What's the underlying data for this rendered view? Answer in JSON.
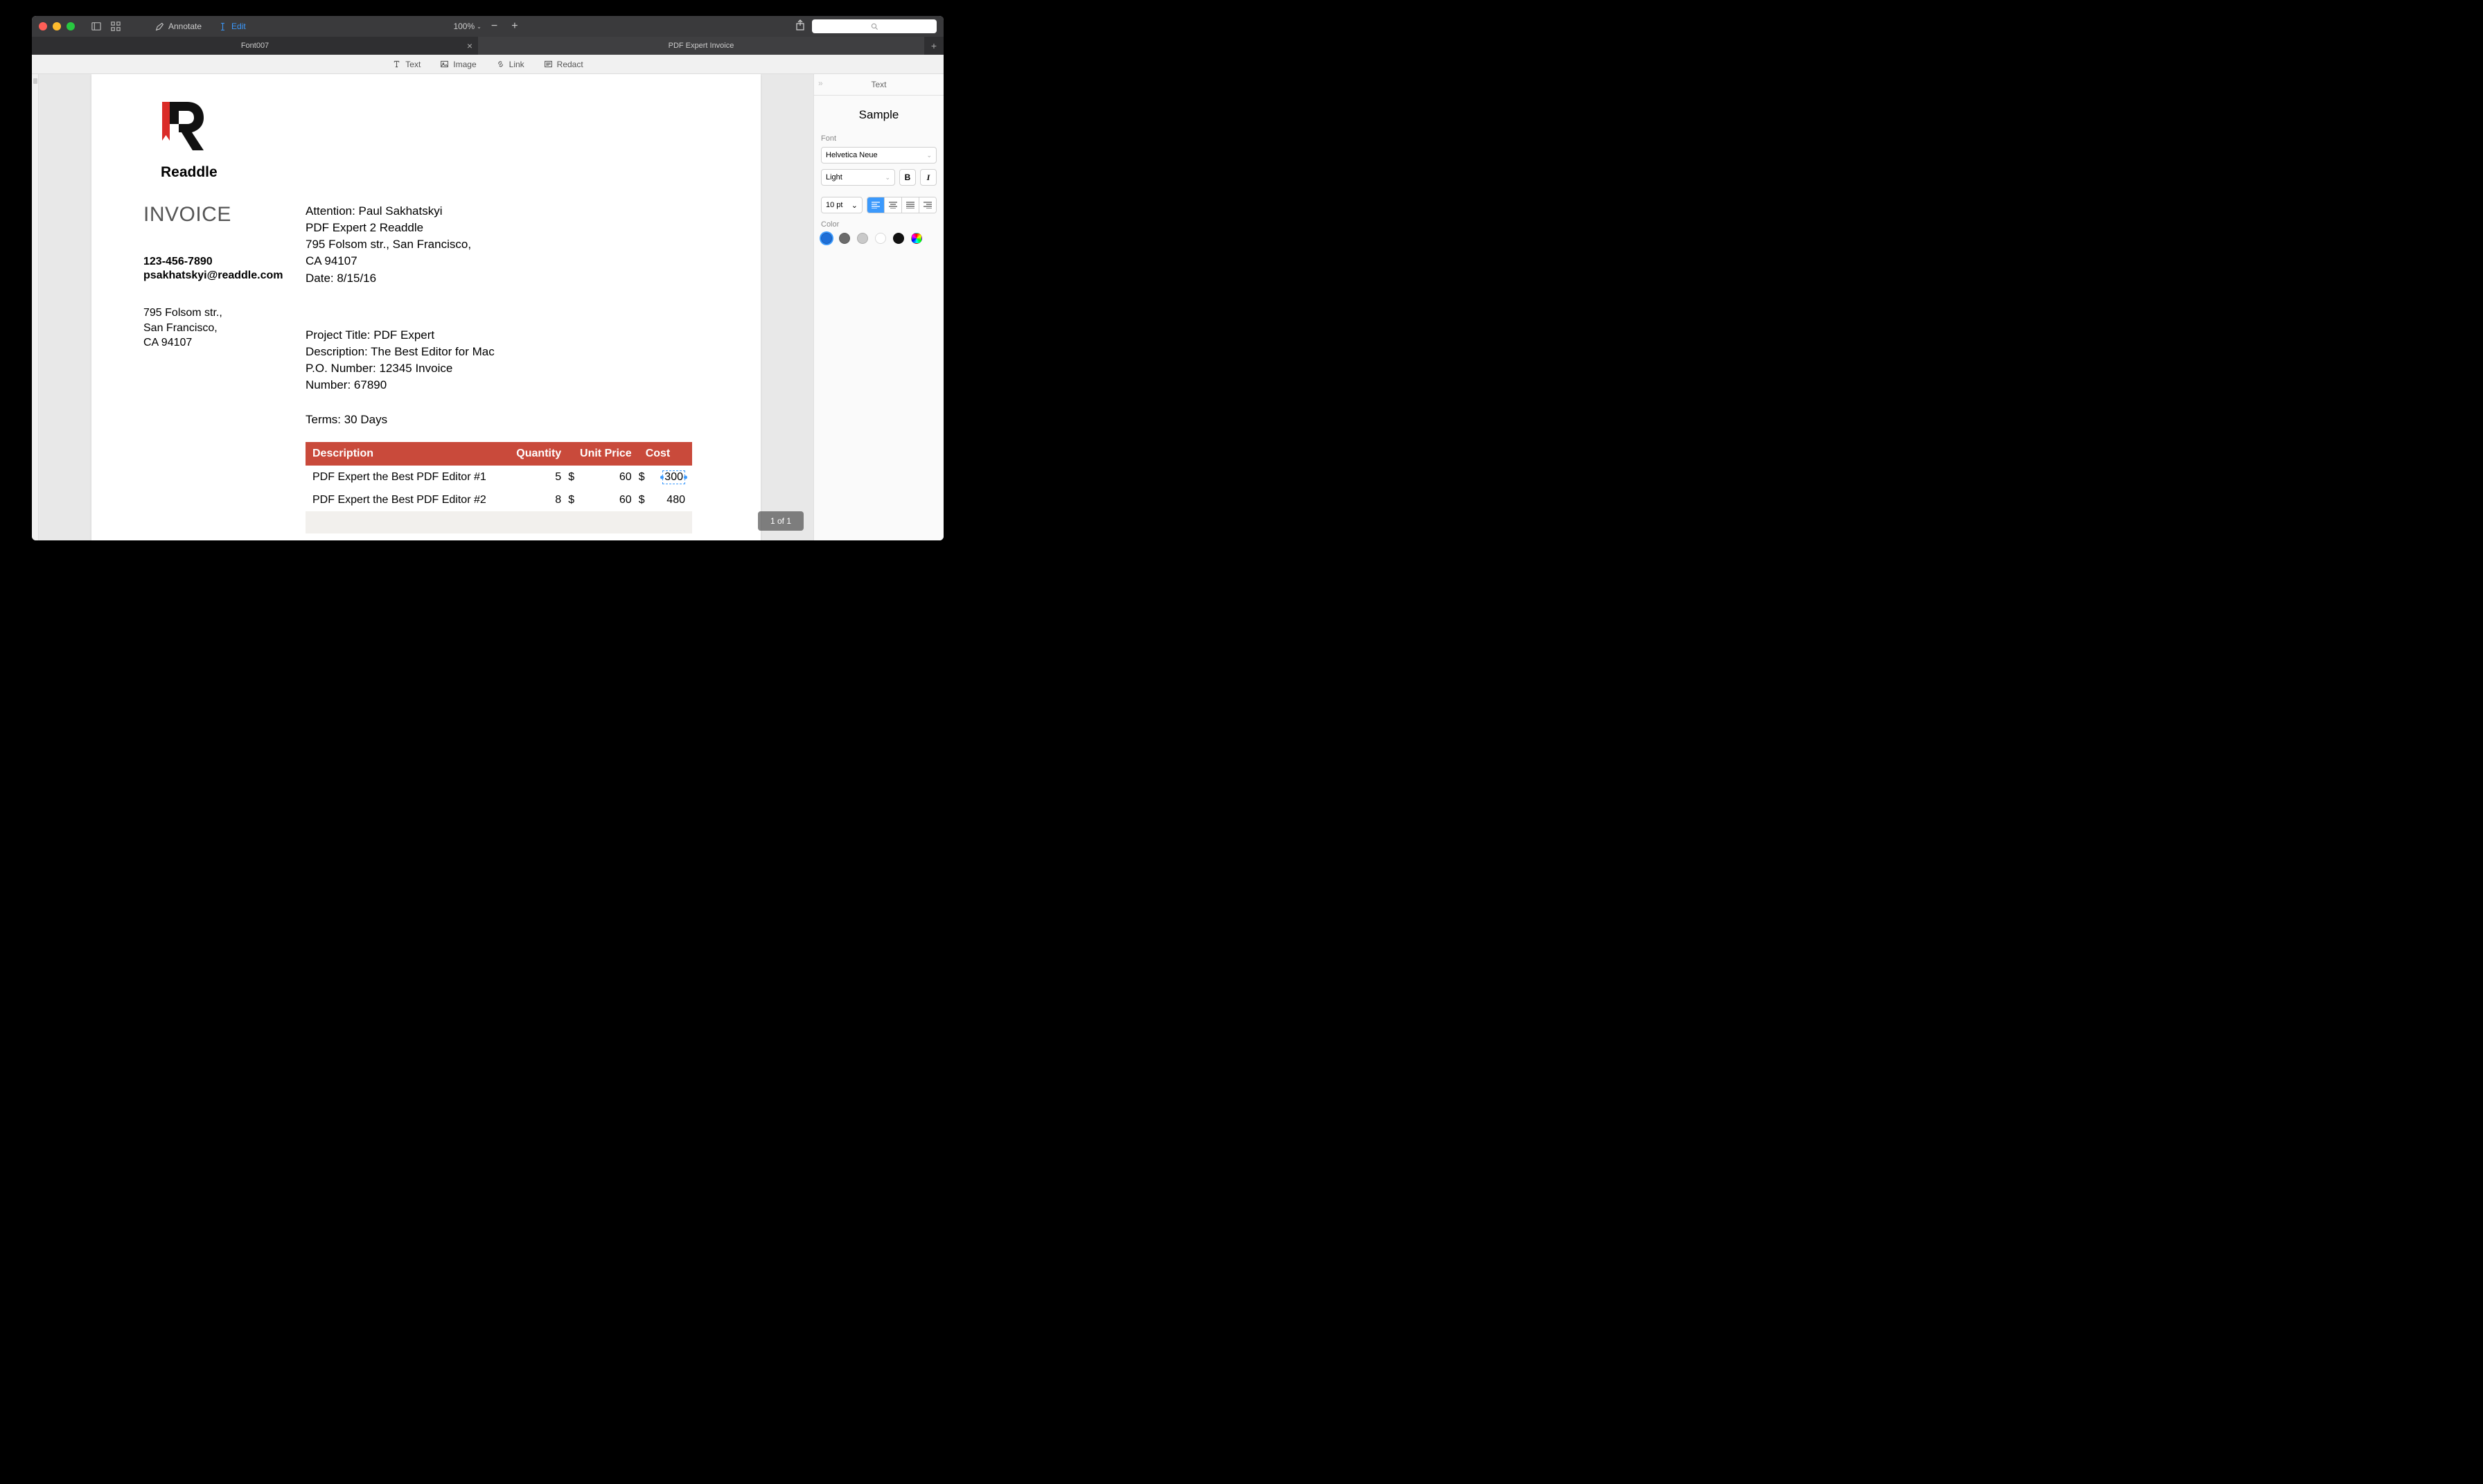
{
  "toolbar": {
    "annotate": "Annotate",
    "edit": "Edit",
    "zoom": "100%",
    "search_placeholder": ""
  },
  "tabs": {
    "tab1": "Font007",
    "tab2": "PDF Expert Invoice"
  },
  "tools": {
    "text": "Text",
    "image": "Image",
    "link": "Link",
    "redact": "Redact"
  },
  "doc": {
    "company": "Readdle",
    "title": "INVOICE",
    "phone": "123-456-7890",
    "email": "psakhatskyi@readdle.com",
    "addr1": "795 Folsom str.,",
    "addr2": "San Francisco,",
    "addr3": "CA 94107",
    "attn1": "Attention: Paul Sakhatskyi",
    "attn2": "PDF Expert 2 Readdle",
    "attn3": "795 Folsom str., San Francisco,",
    "attn4": "CA 94107",
    "attn5": "Date: 8/15/16",
    "proj1": "Project Title: PDF Expert",
    "proj2": "Description: The Best Editor for Mac",
    "proj3": "P.O. Number: 12345 Invoice",
    "proj4": "Number: 67890",
    "terms": "Terms: 30 Days",
    "th_desc": "Description",
    "th_qty": "Quantity",
    "th_price": "Unit Price",
    "th_cost": "Cost",
    "r1_desc": "PDF Expert the Best PDF Editor #1",
    "r1_qty": "5",
    "r1_cur1": "$",
    "r1_price": "60",
    "r1_cur2": "$",
    "r1_cost": "300",
    "r2_desc": "PDF Expert the Best PDF Editor #2",
    "r2_qty": "8",
    "r2_cur1": "$",
    "r2_price": "60",
    "r2_cur2": "$",
    "r2_cost": "480"
  },
  "page_indicator": "1 of 1",
  "sidepanel": {
    "title": "Text",
    "sample": "Sample",
    "font_label": "Font",
    "font": "Helvetica Neue",
    "weight": "Light",
    "bold": "B",
    "italic": "I",
    "size": "10 pt",
    "color_label": "Color",
    "colors": {
      "c1": "#1e6fd8",
      "c2": "#6b6b6b",
      "c3": "#c9c9c9",
      "c4": "#ffffff",
      "c5": "#111111"
    }
  }
}
